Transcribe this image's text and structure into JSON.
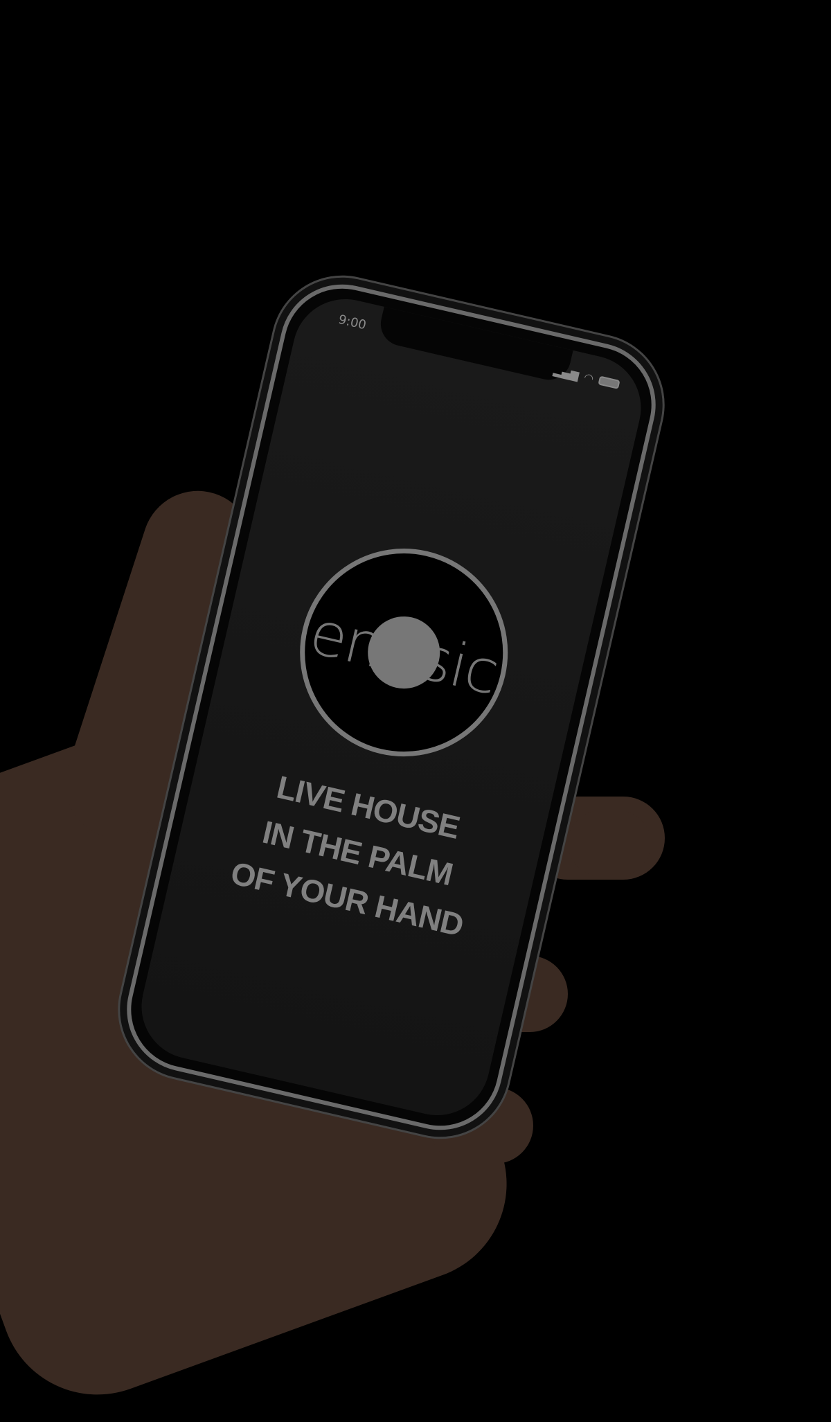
{
  "status_bar": {
    "time": "9:00",
    "signal_icon": "signal-icon",
    "wifi_icon": "wifi-icon",
    "battery_icon": "battery-icon"
  },
  "logo": {
    "wordmark_left": "en",
    "wordmark_right": "sic",
    "color": "#777777"
  },
  "tagline": [
    "LIVE HOUSE",
    "IN THE PALM",
    "OF YOUR HAND"
  ]
}
